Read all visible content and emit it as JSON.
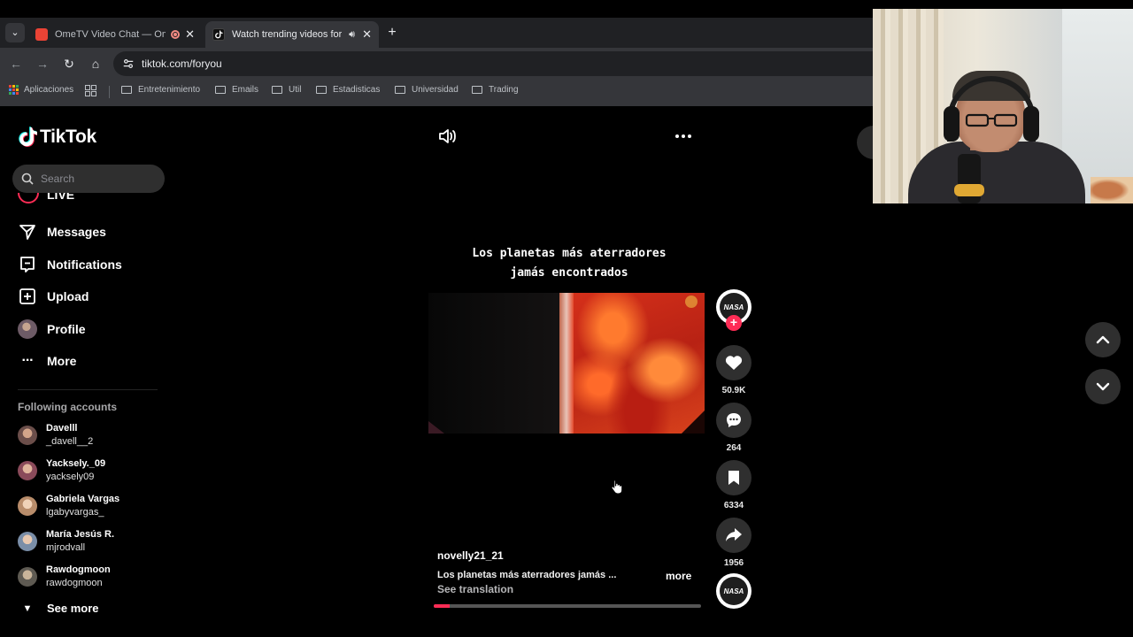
{
  "browser": {
    "tabs": [
      {
        "title": "OmeTV Video Chat — OmeTV",
        "active": false,
        "favicon_color": "#ea4335",
        "indicator": "recording"
      },
      {
        "title": "Watch trending videos for you",
        "active": true,
        "favicon_color": "#000000",
        "indicator": "audio"
      }
    ],
    "url": "tiktok.com/foryou",
    "bookmarks": {
      "apps_label": "Aplicaciones",
      "folders": [
        "Entretenimiento",
        "Emails",
        "Util",
        "Estadisticas",
        "Universidad",
        "Trading"
      ]
    }
  },
  "tiktok": {
    "brand": "TikTok",
    "search_placeholder": "Search",
    "nav": {
      "live": "LIVE",
      "messages": "Messages",
      "notifications": "Notifications",
      "upload": "Upload",
      "profile": "Profile",
      "more": "More"
    },
    "following": {
      "title": "Following accounts",
      "accounts": [
        {
          "name": "Davelll",
          "username": "_davell__2",
          "color": "#6b4e4a"
        },
        {
          "name": "Yacksely._09",
          "username": "yacksely09",
          "color": "#8a4a5a"
        },
        {
          "name": "Gabriela Vargas",
          "username": "lgabyvargas_",
          "color": "#b88c6a"
        },
        {
          "name": "María Jesús R.",
          "username": "mjrodvall",
          "color": "#7a8ea8"
        },
        {
          "name": "Rawdogmoon",
          "username": "rawdogmoon",
          "color": "#5e5a52"
        }
      ],
      "see_more": "See more"
    },
    "video": {
      "overlay_title_line1": "Los planetas más aterradores",
      "overlay_title_line2": "jamás encontrados",
      "author": "novelly21_21",
      "description": "Los planetas más aterradores jamás ...",
      "more_label": "more",
      "see_translation": "See translation",
      "progress_fraction": 0.06,
      "creator_avatar_text": "NASA"
    },
    "actions": {
      "likes": "50.9K",
      "comments": "264",
      "saves": "6334",
      "shares": "1956"
    },
    "accent_color": "#fe2c55"
  }
}
